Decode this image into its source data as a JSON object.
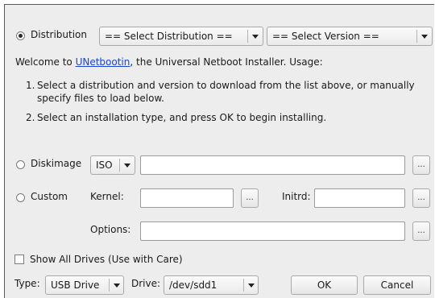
{
  "distribution": {
    "radio_label": "Distribution",
    "distro_select": "== Select Distribution ==",
    "version_select": "== Select Version =="
  },
  "intro": {
    "before_link": "Welcome to ",
    "link": "UNetbootin",
    "after_link": ", the Universal Netboot Installer. Usage:"
  },
  "instructions": [
    {
      "num": "1.",
      "text": "Select a distribution and version to download from the list above, or manually specify files to load below."
    },
    {
      "num": "2.",
      "text": "Select an installation type, and press OK to begin installing."
    }
  ],
  "diskimage": {
    "radio_label": "Diskimage",
    "format": "ISO",
    "path": "",
    "browse": "..."
  },
  "custom": {
    "radio_label": "Custom",
    "kernel_label": "Kernel:",
    "kernel_value": "",
    "kernel_browse": "...",
    "initrd_label": "Initrd:",
    "initrd_value": "",
    "initrd_browse": "...",
    "options_label": "Options:",
    "options_value": "",
    "options_browse": "..."
  },
  "show_all_drives": {
    "label": "Show All Drives (Use with Care)",
    "checked": false
  },
  "bottom": {
    "type_label": "Type:",
    "type_value": "USB Drive",
    "drive_label": "Drive:",
    "drive_value": "/dev/sdd1",
    "ok": "OK",
    "cancel": "Cancel"
  }
}
